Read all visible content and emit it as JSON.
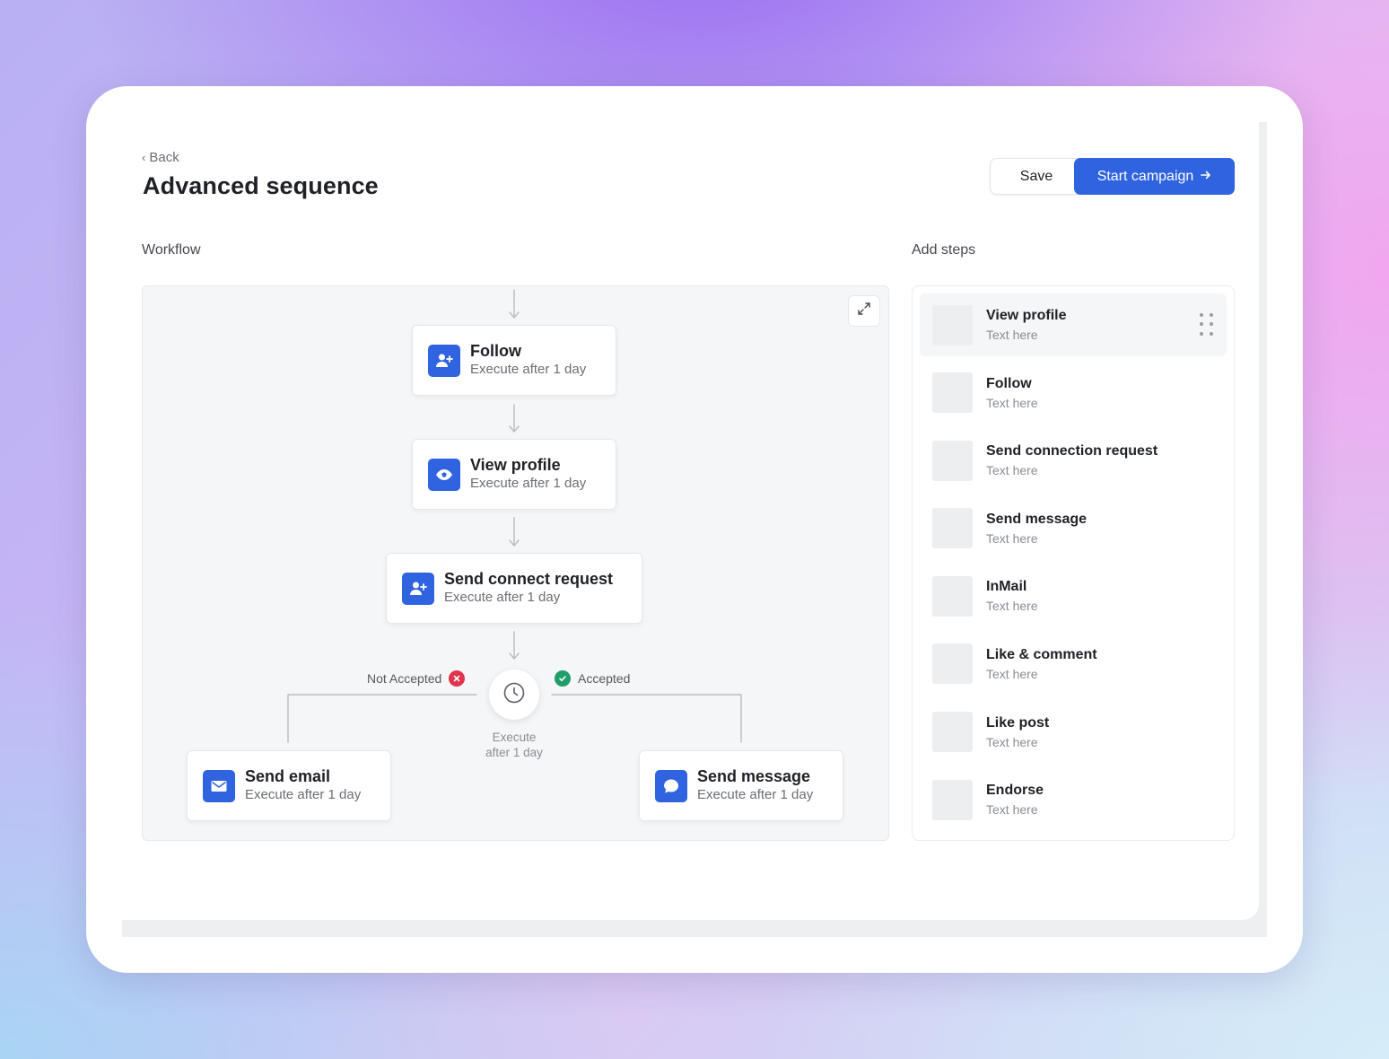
{
  "header": {
    "back_label": "Back",
    "title": "Advanced sequence",
    "save_label": "Save",
    "start_label": "Start campaign"
  },
  "workflow": {
    "section_label": "Workflow",
    "nodes": [
      {
        "title": "Follow",
        "subtitle": "Execute after 1 day",
        "icon": "user-plus-icon"
      },
      {
        "title": "View profile",
        "subtitle": "Execute after 1 day",
        "icon": "eye-icon"
      },
      {
        "title": "Send connect request",
        "subtitle": "Execute after 1 day",
        "icon": "user-plus-icon"
      },
      {
        "title": "Send email",
        "subtitle": "Execute after 1 day",
        "icon": "mail-icon"
      },
      {
        "title": "Send message",
        "subtitle": "Execute after 1 day",
        "icon": "chat-bubble-icon"
      }
    ],
    "branch": {
      "not_accepted_label": "Not Accepted",
      "accepted_label": "Accepted",
      "timer_line1": "Execute",
      "timer_line2": "after 1 day"
    }
  },
  "steps": {
    "section_label": "Add steps",
    "items": [
      {
        "title": "View profile",
        "subtitle": "Text here"
      },
      {
        "title": "Follow",
        "subtitle": "Text here"
      },
      {
        "title": "Send connection request",
        "subtitle": "Text here"
      },
      {
        "title": "Send message",
        "subtitle": "Text here"
      },
      {
        "title": "InMail",
        "subtitle": "Text here"
      },
      {
        "title": "Like & comment",
        "subtitle": "Text here"
      },
      {
        "title": "Like post",
        "subtitle": "Text here"
      },
      {
        "title": "Endorse",
        "subtitle": "Text here"
      }
    ]
  },
  "colors": {
    "accent": "#2f63e0",
    "danger": "#e0344c",
    "success": "#1f9d6a"
  }
}
